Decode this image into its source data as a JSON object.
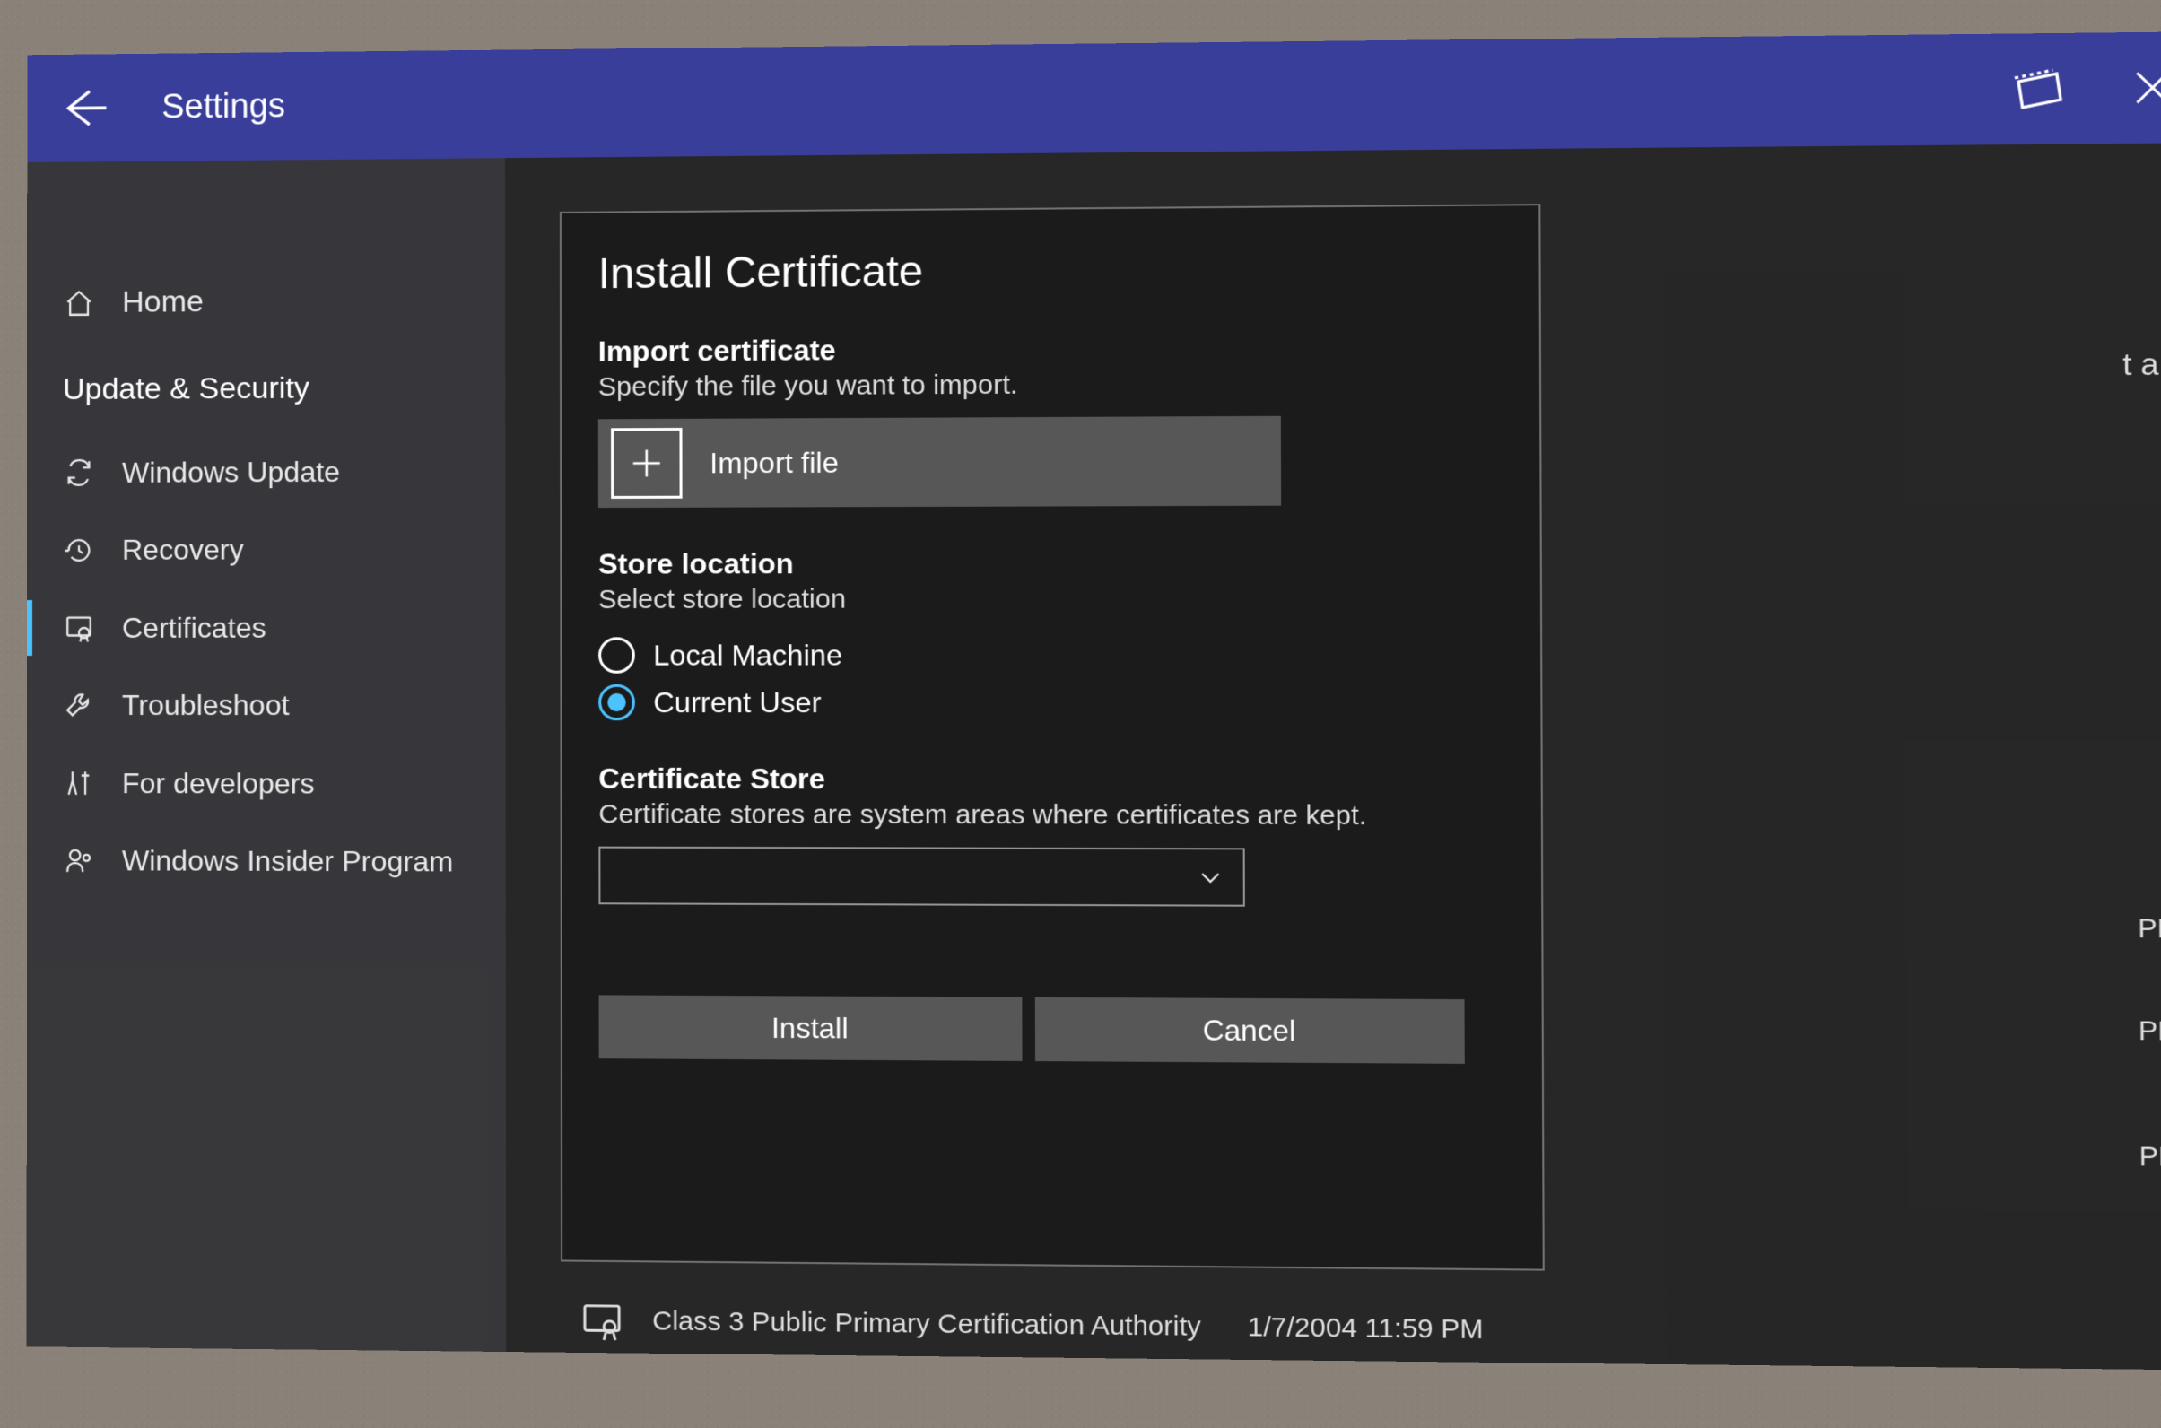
{
  "titlebar": {
    "title": "Settings"
  },
  "sidebar": {
    "home": "Home",
    "section": "Update & Security",
    "items": [
      {
        "id": "windows-update",
        "label": "Windows Update"
      },
      {
        "id": "recovery",
        "label": "Recovery"
      },
      {
        "id": "certificates",
        "label": "Certificates"
      },
      {
        "id": "troubleshoot",
        "label": "Troubleshoot"
      },
      {
        "id": "for-developers",
        "label": "For developers"
      },
      {
        "id": "windows-insider",
        "label": "Windows Insider Program"
      }
    ]
  },
  "dialog": {
    "title": "Install Certificate",
    "import": {
      "head": "Import certificate",
      "sub": "Specify the file you want to import.",
      "button": "Import file"
    },
    "store_location": {
      "head": "Store location",
      "sub": "Select store location",
      "options": {
        "local": "Local Machine",
        "user": "Current User"
      },
      "selected": "user"
    },
    "cert_store": {
      "head": "Certificate Store",
      "sub": "Certificate stores are system areas where certificates are kept.",
      "value": ""
    },
    "buttons": {
      "install": "Install",
      "cancel": "Cancel"
    }
  },
  "background": {
    "partial_a": "t a",
    "pm1": "PM",
    "pm2": "PM",
    "pm3": "PM",
    "last_row_name": "Class 3 Public Primary Certification Authority",
    "last_row_time": "1/7/2004 11:59 PM"
  }
}
